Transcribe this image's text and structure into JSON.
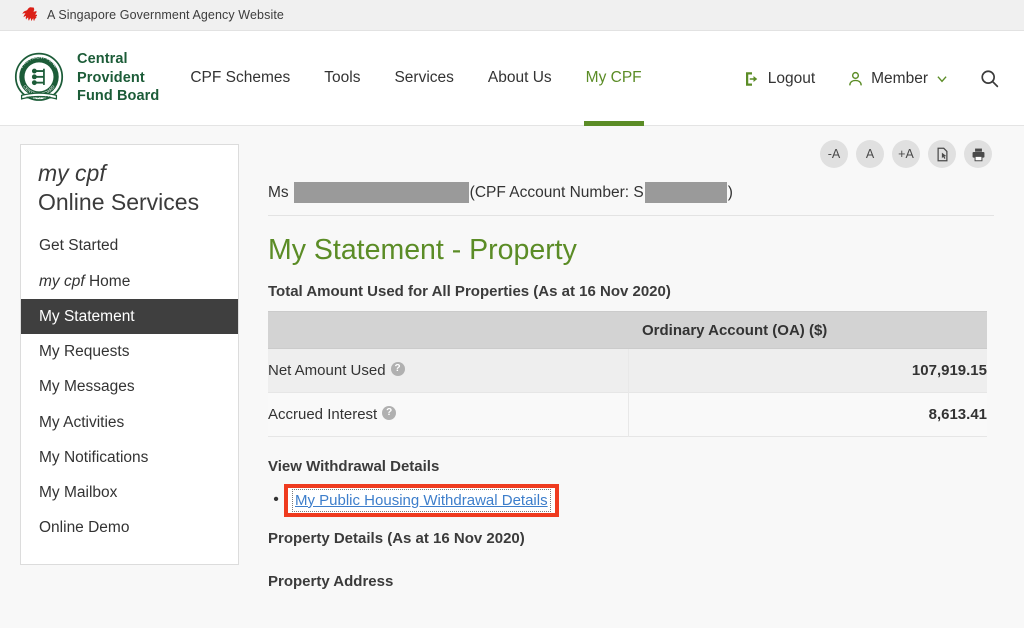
{
  "gov_bar": {
    "text": "A Singapore Government Agency Website",
    "lion_icon": "singapore-lion-icon"
  },
  "header": {
    "brand": {
      "line1": "Central",
      "line2": "Provident",
      "line3": "Fund Board",
      "seal_icon": "cpf-seal-logo"
    },
    "nav": [
      {
        "label": "CPF Schemes",
        "active": false
      },
      {
        "label": "Tools",
        "active": false
      },
      {
        "label": "Services",
        "active": false
      },
      {
        "label": "About Us",
        "active": false
      },
      {
        "label": "My CPF",
        "active": true
      }
    ],
    "logout": {
      "label": "Logout",
      "icon": "logout-icon"
    },
    "member": {
      "label": "Member",
      "icon": "person-icon",
      "chevron": "chevron-down-icon"
    },
    "search": {
      "icon": "search-icon"
    },
    "accent_green": "#5b8c26",
    "brand_green": "#1c5c38"
  },
  "sidebar": {
    "title_italic": "my cpf",
    "title_main": "Online Services",
    "items": [
      {
        "label": "Get Started",
        "active": false
      },
      {
        "label": "my cpf Home",
        "active": false,
        "italic_prefix": "my cpf",
        "rest": " Home"
      },
      {
        "label": "My Statement",
        "active": true
      },
      {
        "label": "My Requests",
        "active": false
      },
      {
        "label": "My Messages",
        "active": false
      },
      {
        "label": "My Activities",
        "active": false
      },
      {
        "label": "My Notifications",
        "active": false
      },
      {
        "label": "My Mailbox",
        "active": false
      },
      {
        "label": "Online Demo",
        "active": false
      }
    ]
  },
  "accessibility": {
    "decrease_font": "-A",
    "normal_font": "A",
    "increase_font": "+A",
    "document_icon": "document-cursor-icon",
    "print_icon": "printer-icon"
  },
  "account": {
    "salutation": "Ms",
    "name_redacted": "",
    "account_prefix": "(CPF Account Number: S",
    "account_redacted": "",
    "account_suffix": ")"
  },
  "main": {
    "page_title": "My Statement - Property",
    "total_heading": "Total Amount Used for All Properties (As at 16 Nov 2020)",
    "table": {
      "col_blank_header": "",
      "col_oa_header": "Ordinary Account (OA) ($)",
      "rows": [
        {
          "label": "Net Amount Used",
          "help": "?",
          "value": "107,919.15"
        },
        {
          "label": "Accrued Interest",
          "help": "?",
          "value": "8,613.41"
        }
      ]
    },
    "withdrawal_heading": "View Withdrawal Details",
    "withdrawal_link": "My Public Housing Withdrawal Details",
    "property_details_heading": "Property Details (As at 16 Nov 2020)",
    "property_address_heading": "Property Address",
    "highlight_color": "#ef3b1f",
    "link_color": "#3d7ecb"
  }
}
